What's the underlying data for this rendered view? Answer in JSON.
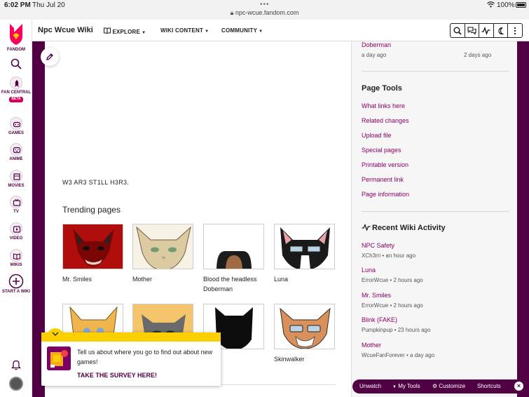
{
  "status_bar": {
    "time": "6:02 PM",
    "date": "Thu Jul 20",
    "url": "npc-wcue.fandom.com",
    "battery": "100%"
  },
  "rail": {
    "logo_label": "FANDOM",
    "fan_central": "FAN CENTRAL",
    "beta": "BETA",
    "games": "GAMES",
    "anime": "ANIME",
    "movies": "MOVIES",
    "tv": "TV",
    "video": "VIDEO",
    "wikis": "WIKIS",
    "start_wiki": "START A WIKI"
  },
  "header": {
    "wiki_name": "Npc Wcue Wiki",
    "nav": [
      "EXPLORE",
      "WIKI CONTENT",
      "COMMUNITY"
    ]
  },
  "main": {
    "article_text": "W3 AR3 ST1LL H3R3.",
    "trending_title": "Trending pages",
    "trending": [
      {
        "label": "Mr. Smiles"
      },
      {
        "label": "Mother"
      },
      {
        "label": "Blood the headless Doberman"
      },
      {
        "label": "Luna"
      },
      {
        "label": ""
      },
      {
        "label": ""
      },
      {
        "label": "r"
      },
      {
        "label": "Skinwalker"
      }
    ]
  },
  "sidebar": {
    "top_link": "Doberman",
    "top_meta_left": "a day ago",
    "top_meta_right": "2 days ago",
    "page_tools_title": "Page Tools",
    "page_tools": [
      "What links here",
      "Related changes",
      "Upload file",
      "Special pages",
      "Printable version",
      "Permanent link",
      "Page information"
    ],
    "activity_title": "Recent Wiki Activity",
    "activity": [
      {
        "title": "NPC Safety",
        "meta": "XCh3rri • an hour ago"
      },
      {
        "title": "Luna",
        "meta": "ErrorWcue • 2 hours ago"
      },
      {
        "title": "Mr. Smiles",
        "meta": "ErrorWcue • 2 hours ago"
      },
      {
        "title": "Blink (FAKE)",
        "meta": "Pumpkinpup • 23 hours ago"
      },
      {
        "title": "Mother",
        "meta": "WcueFanForever • a day ago"
      }
    ]
  },
  "survey": {
    "text": "Tell us about where you go to find out about new games!",
    "link": "TAKE THE SURVEY HERE!"
  },
  "toolbar": {
    "unwatch": "Unwatch",
    "my_tools": "My Tools",
    "customize": "Customize",
    "shortcuts": "Shortcuts"
  },
  "colors": {
    "brand": "#520044",
    "link": "#8a0063",
    "survey_yellow": "#fbd000",
    "fandom_pink": "#fa005a"
  }
}
